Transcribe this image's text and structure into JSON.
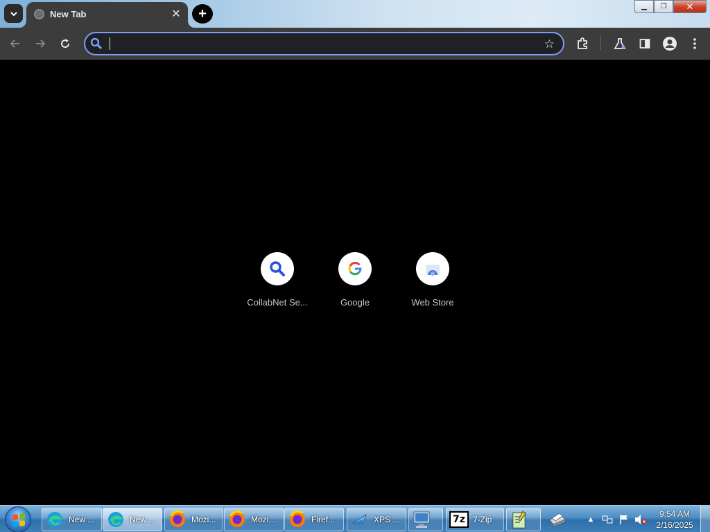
{
  "tab": {
    "title": "New Tab",
    "close_symbol": "✕"
  },
  "new_tab_symbol": "+",
  "window": {
    "min": "▁",
    "restore": "❐",
    "close": "✕"
  },
  "omnibox": {
    "value": "",
    "placeholder": ""
  },
  "shortcuts": [
    {
      "label": "CollabNet Se...",
      "icon": "search-icon"
    },
    {
      "label": "Google",
      "icon": "google-icon"
    },
    {
      "label": "Web Store",
      "icon": "web-store-icon"
    }
  ],
  "taskbar": {
    "items": [
      {
        "label": "New ...",
        "icon": "edge-icon"
      },
      {
        "label": "New ...",
        "icon": "edge-icon"
      },
      {
        "label": "Mozi...",
        "icon": "firefox-icon"
      },
      {
        "label": "Mozi...",
        "icon": "firefox-icon"
      },
      {
        "label": "Firef...",
        "icon": "firefox-icon"
      },
      {
        "label": "XPS ...",
        "icon": "xps-viewer-icon"
      },
      {
        "label": "",
        "icon": "remote-desktop-icon"
      },
      {
        "label": "7-Zip",
        "icon": "7zip-icon"
      },
      {
        "label": "",
        "icon": "notepad-icon"
      },
      {
        "label": "",
        "icon": "printer-icon"
      }
    ],
    "sevenzip_logo": "7z",
    "tray_arrow": "▲",
    "clock": {
      "time": "9:54 AM",
      "date": "2/16/2025"
    }
  },
  "colors": {
    "accent": "#7b9ff7",
    "toolbar": "#3c3c3c",
    "content_bg": "#000000"
  }
}
